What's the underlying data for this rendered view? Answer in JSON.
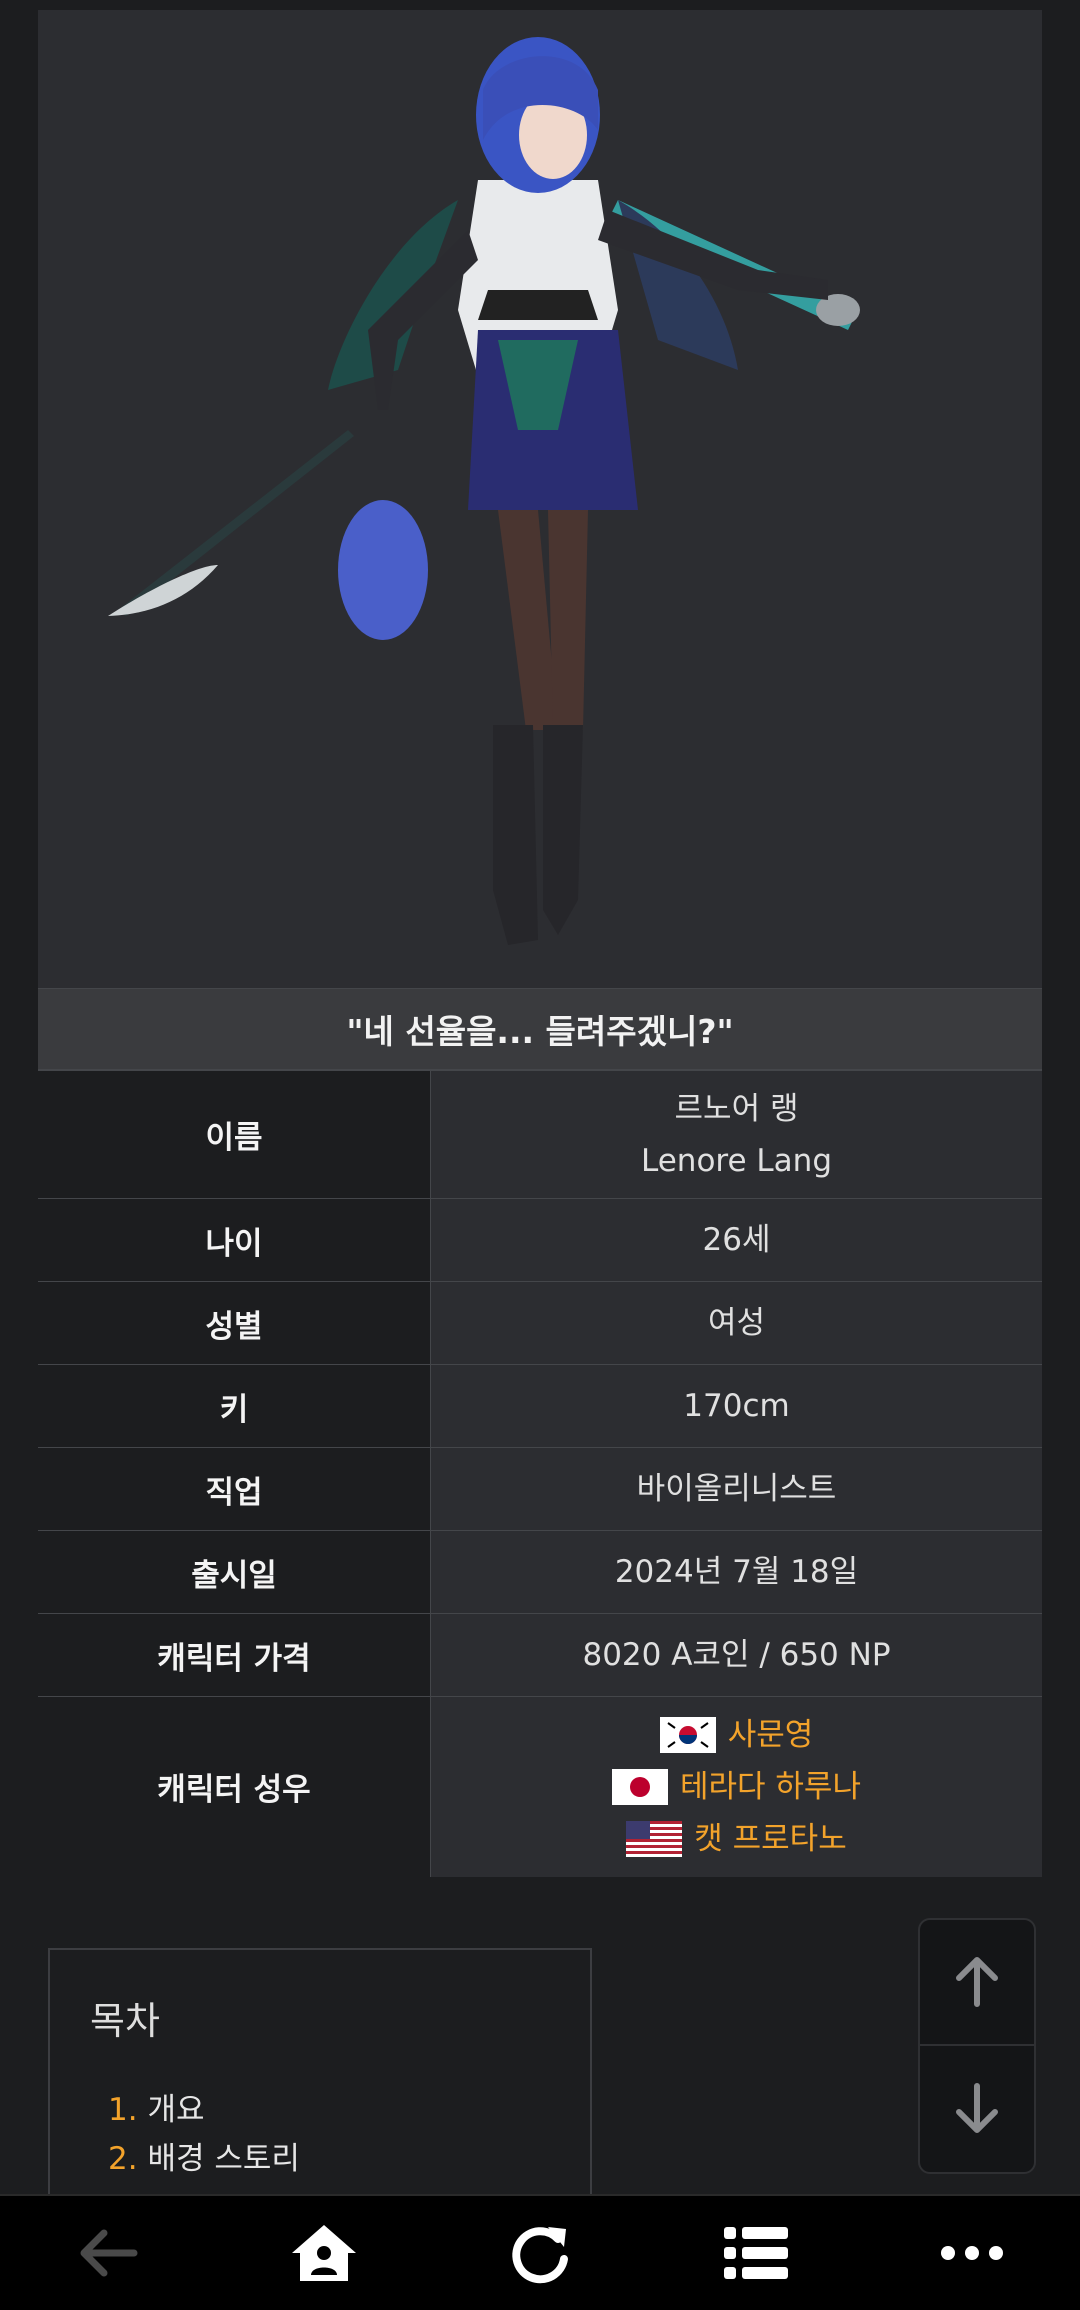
{
  "infobox": {
    "quote": "\"네 선율을... 들려주겠니?\"",
    "rows": [
      {
        "label": "나이",
        "value": "26세"
      },
      {
        "label": "성별",
        "value": "여성"
      },
      {
        "label": "키",
        "value": "170cm"
      },
      {
        "label": "직업",
        "value": "바이올리니스트"
      },
      {
        "label": "출시일",
        "value": "2024년 7월 18일"
      },
      {
        "label": "캐릭터 가격",
        "value": "8020 A코인 / 650 NP"
      }
    ],
    "name_label": "이름",
    "name_ko": "르노어 랭",
    "name_en": "Lenore Lang",
    "voice_label": "캐릭터 성우",
    "voice_actors": [
      {
        "name": "사문영",
        "flag": "korea-flag-icon"
      },
      {
        "name": "테라다 하루나",
        "flag": "japan-flag-icon"
      },
      {
        "name": "캣 프로타노",
        "flag": "usa-flag-icon"
      }
    ]
  },
  "toc": {
    "title": "목차",
    "items": [
      {
        "num": "1.",
        "label": "개요"
      },
      {
        "num": "2.",
        "label": "배경 스토리"
      }
    ]
  },
  "scroll": {
    "up_icon": "arrow-up-icon",
    "down_icon": "arrow-down-icon"
  },
  "bottom_nav": [
    "back-arrow-icon",
    "home-icon",
    "refresh-icon",
    "menu-list-icon",
    "more-icon"
  ],
  "colors": {
    "accent": "#f3a32b",
    "background": "#1c1d1f",
    "panel": "#2c2d31"
  }
}
